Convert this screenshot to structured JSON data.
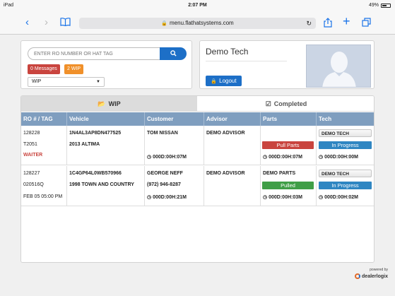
{
  "status_bar": {
    "device": "iPad",
    "time": "2:07 PM",
    "battery": "49%"
  },
  "browser": {
    "url": "menu.flathatsystems.com"
  },
  "search": {
    "placeholder": "ENTER RO NUMBER OR HAT TAG",
    "button_icon": "search-icon"
  },
  "badges": {
    "messages": "0 Messages",
    "wip": "2 WIP"
  },
  "filter": {
    "selected": "WIP"
  },
  "user": {
    "name": "Demo Tech",
    "logout_label": "Logout"
  },
  "tabs": [
    {
      "label": "WIP",
      "icon": "folder-open-icon",
      "active": true
    },
    {
      "label": "Completed",
      "icon": "check-square-icon",
      "active": false
    }
  ],
  "table": {
    "headers": [
      "RO # / TAG",
      "Vehicle",
      "Customer",
      "Advisor",
      "Parts",
      "Tech"
    ],
    "rows": [
      {
        "ro": "128228",
        "tag": "T2051",
        "note": "WAITER",
        "vin": "1N4AL3AP8DN477525",
        "vehicle": "2013 ALTIMA",
        "customer": "TOM NISSAN",
        "customer_phone": "",
        "customer_timer": "000D:00H:07M",
        "advisor": "DEMO ADVISOR",
        "parts_by": "",
        "parts_status": "Pull Parts",
        "parts_timer": "000D:00H:07M",
        "tech": "DEMO TECH",
        "tech_status": "In Progress",
        "tech_timer": "000D:00H:00M"
      },
      {
        "ro": "128227",
        "tag": "020516Q",
        "note": "FEB 05 05:00 PM",
        "vin": "1C4GP64L0WB570966",
        "vehicle": "1998 TOWN AND COUNTRY",
        "customer": "GEORGE NEFF",
        "customer_phone": "(972) 946-8287",
        "customer_timer": "000D:00H:21M",
        "advisor": "DEMO ADVISOR",
        "parts_by": "DEMO PARTS",
        "parts_status": "Pulled",
        "parts_timer": "000D:00H:03M",
        "tech": "DEMO TECH",
        "tech_status": "In Progress",
        "tech_timer": "000D:00H:02M"
      }
    ]
  },
  "footer": {
    "powered_by": "powered by",
    "brand": "dealerlogix"
  },
  "colors": {
    "primary": "#1d6fc7",
    "header": "#7f9ebf",
    "danger": "#c9443e",
    "warning": "#f0902a",
    "success": "#3f9e47",
    "info": "#2f86c2"
  }
}
